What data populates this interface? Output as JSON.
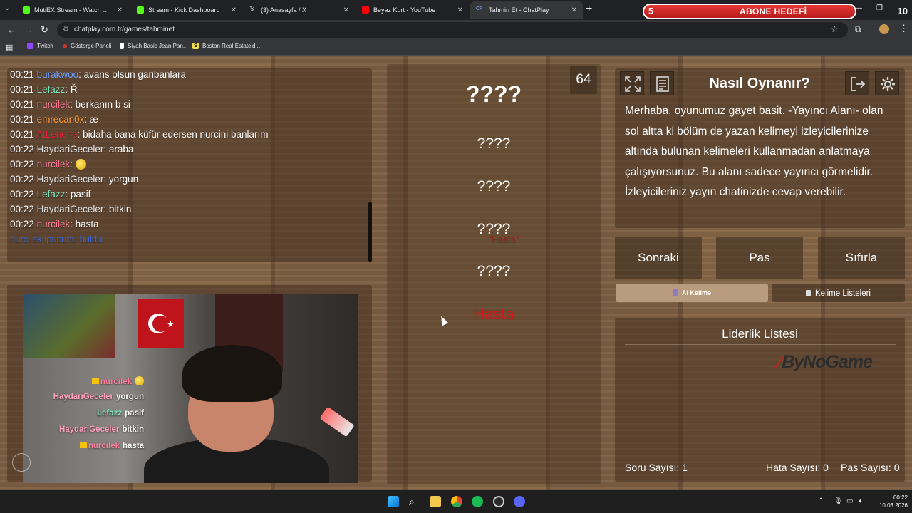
{
  "browser": {
    "tabs": [
      {
        "title": "MutiEX Stream - Watch Live on",
        "favicon_color": "#53fc18"
      },
      {
        "title": "Stream - Kick Dashboard",
        "favicon_color": "#53fc18"
      },
      {
        "title": "(3) Anasayfa / X",
        "favicon_color": "#e8eaed"
      },
      {
        "title": "Beyaz Kurt - YouTube",
        "favicon_color": "#ff0000"
      },
      {
        "title": "Tahmin Et - ChatPlay",
        "favicon_color": "#8ab4f8",
        "favicon_text": "CP",
        "active": true
      }
    ],
    "url": "chatplay.com.tr/games/tahminet",
    "bookmarks": [
      {
        "label": "Twitch",
        "color": "#9146ff"
      },
      {
        "label": "Gösterge Paneli",
        "color": "#d93025"
      },
      {
        "label": "Siyah Basic Jean Pan...",
        "color": "#202124"
      },
      {
        "label": "Boston Real Estate'd...",
        "color": "#f4e04d",
        "icon_text": "S"
      }
    ]
  },
  "overlay": {
    "left_number": "5",
    "label": "ABONE HEDEFİ",
    "right_number": "10"
  },
  "chat": {
    "lines": [
      {
        "time": "00:21",
        "user": "burakwoo",
        "color": "#6fa3ff",
        "message": "avans olsun garibanlara"
      },
      {
        "time": "00:21",
        "user": "Lefazz",
        "color": "#7be3c0",
        "message": "Ř"
      },
      {
        "time": "00:21",
        "user": "nurcilek",
        "color": "#ff7e9a",
        "message": "berkanın b si"
      },
      {
        "time": "00:21",
        "user": "emrecan0x",
        "color": "#ff9d3b",
        "message": "æ"
      },
      {
        "time": "00:21",
        "user": "AtLenene",
        "color": "#e0223a",
        "message": "bidaha bana küfür edersen nurcini banlarım"
      },
      {
        "time": "00:22",
        "user": "HaydariGeceler",
        "color": "#e8e8e8",
        "message": "araba"
      },
      {
        "time": "00:22",
        "user": "nurcilek",
        "color": "#ff7e9a",
        "message": "",
        "emoji": true
      },
      {
        "time": "00:22",
        "user": "HaydariGeceler",
        "color": "#e8e8e8",
        "message": "yorgun"
      },
      {
        "time": "00:22",
        "user": "Lefazz",
        "color": "#7be3c0",
        "message": "pasif"
      },
      {
        "time": "00:22",
        "user": "HaydariGeceler",
        "color": "#e8e8e8",
        "message": "bitkin"
      },
      {
        "time": "00:22",
        "user": "nurcilek",
        "color": "#ff7e9a",
        "message": "hasta"
      }
    ],
    "found": {
      "user": "nurcilek",
      "word": "\"Hasta\"",
      "text": "ipucunu buldu."
    }
  },
  "webcam_chat": [
    {
      "user": "nurcilek",
      "color": "#ff7e9a",
      "message": "",
      "badge": true,
      "emoji": true
    },
    {
      "user": "HaydariGeceler",
      "color": "#ff9ec0",
      "message": "yorgun"
    },
    {
      "user": "Lefazz",
      "color": "#7be3c0",
      "message": "pasif"
    },
    {
      "user": "HaydariGeceler",
      "color": "#ff9ec0",
      "message": "bitkin"
    },
    {
      "user": "nurcilek",
      "color": "#ff7e9a",
      "message": "hasta",
      "badge": true
    }
  ],
  "game": {
    "counter": "64",
    "main_word": "????",
    "hints": [
      "????",
      "????",
      "????",
      "????"
    ],
    "answer": "Hasta"
  },
  "how_to": {
    "title": "Nasıl Oynanır?",
    "text": "Merhaba, oyunumuz gayet basit. -Yayıncı Alanı- olan sol altta ki bölüm de yazan kelimeyi izleyicilerinize altında bulunan kelimeleri kullanmadan anlatmaya çalışıyorsunuz. Bu alanı sadece yayıncı görmelidir. İzleyicileriniz yayın chatinizde cevap verebilir."
  },
  "actions": {
    "next": "Sonraki",
    "pass": "Pas",
    "reset": "Sıfırla",
    "ai_word": "AI Kelime",
    "word_lists": "Kelime Listeleri"
  },
  "leaderboard": {
    "title": "Liderlik Listesi",
    "sponsor": "ByNoGame"
  },
  "stats": {
    "questions": "Soru Sayısı: 1",
    "errors": "Hata Sayısı: 0",
    "passes": "Pas Sayısı: 0"
  },
  "taskbar": {
    "time": "00:22",
    "date": "10.03.2026"
  }
}
